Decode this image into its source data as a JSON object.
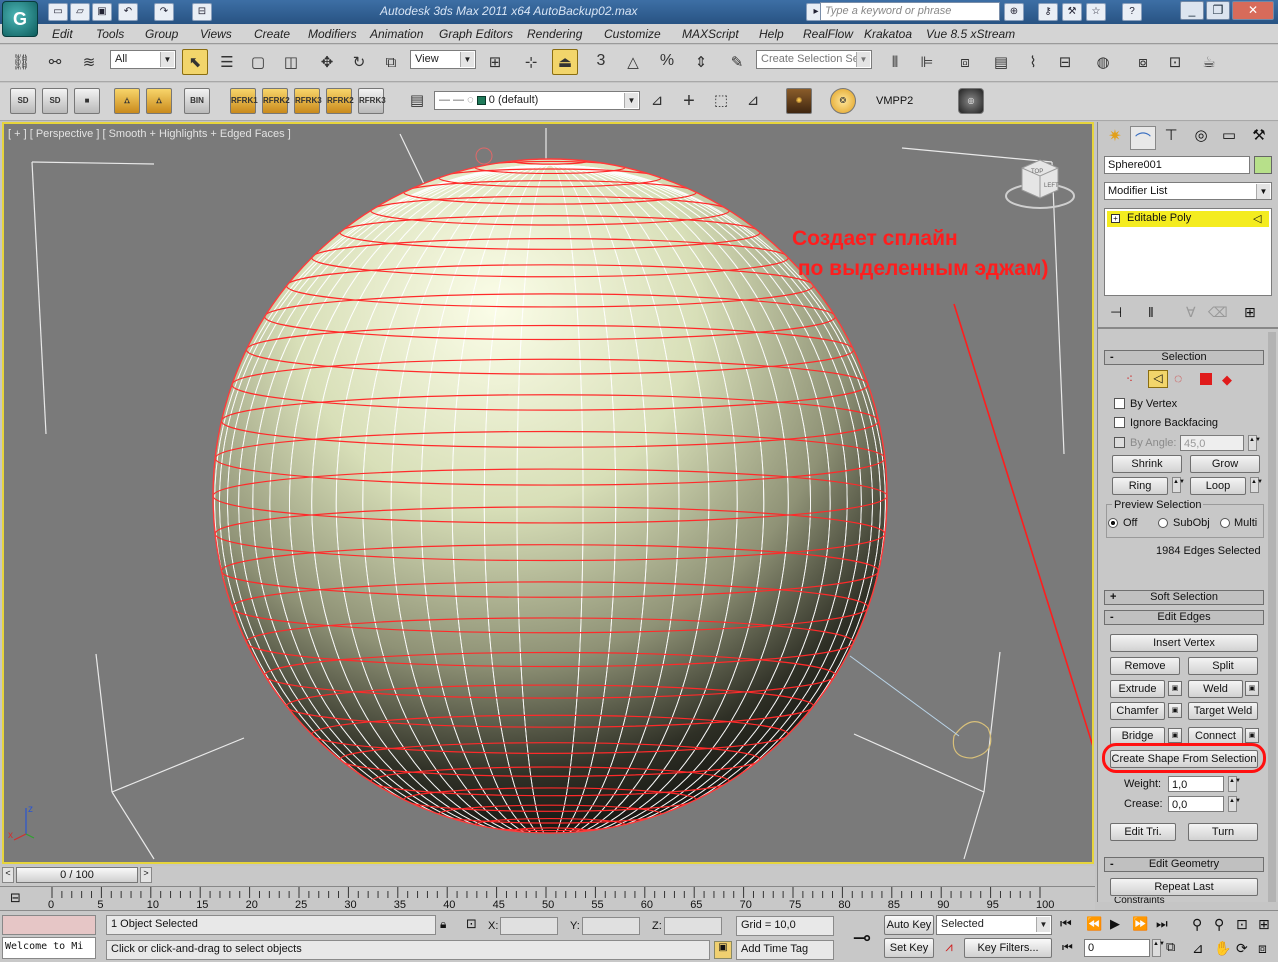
{
  "window": {
    "title": "Autodesk 3ds Max  2011 x64      AutoBackup02.max",
    "app_icon": "3ds-max-logo-icon",
    "search_placeholder": "Type a keyword or phrase",
    "controls": [
      "minimize",
      "restore",
      "close"
    ]
  },
  "menubar": {
    "items": [
      "Edit",
      "Tools",
      "Group",
      "Views",
      "Create",
      "Modifiers",
      "Animation",
      "Graph Editors",
      "Rendering",
      "Customize",
      "MAXScript",
      "Help",
      "RealFlow",
      "Krakatoa",
      "Vue 8.5 xStream"
    ]
  },
  "main_toolbar": {
    "selection_filter": "All",
    "ref_coord": "View",
    "named_selection_placeholder": "Create Selection Se",
    "snap_label": "3",
    "angle_snap_label": "%"
  },
  "extra_toolbar": {
    "layer_value": "0 (default)",
    "vmpp_label": "VMPP2",
    "rfrk_labels": [
      "RFRK1",
      "RFRK2",
      "RFRK3",
      "RFRK2",
      "RFRK3"
    ],
    "bin_label": "BIN",
    "sd_label": "SD"
  },
  "viewport": {
    "label": "[ + ] [ Perspective ] [ Smooth + Highlights + Edged Faces ]",
    "annotation_line1": "Создает сплайн",
    "annotation_line2": " по выделенным эджам)",
    "viewcube_labels": [
      "TOP",
      "LEFT"
    ],
    "axis_labels": [
      "z",
      "x"
    ]
  },
  "command_panel": {
    "tab_icons": [
      "create-icon",
      "modify-icon",
      "hierarchy-icon",
      "motion-icon",
      "display-icon",
      "utilities-icon"
    ],
    "object_name": "Sphere001",
    "object_color": "#b7e08a",
    "modifier_list": "Modifier List",
    "stack_item": "Editable Poly",
    "selection": {
      "title": "Selection",
      "by_vertex": "By Vertex",
      "ignore_backfacing": "Ignore Backfacing",
      "by_angle": "By Angle:",
      "by_angle_value": "45,0",
      "shrink": "Shrink",
      "grow": "Grow",
      "ring": "Ring",
      "loop": "Loop",
      "preview_selection": "Preview Selection",
      "preview_options": [
        "Off",
        "SubObj",
        "Multi"
      ],
      "status": "1984 Edges Selected"
    },
    "soft_selection": {
      "title": "Soft Selection"
    },
    "edit_edges": {
      "title": "Edit Edges",
      "insert_vertex": "Insert Vertex",
      "remove": "Remove",
      "split": "Split",
      "extrude": "Extrude",
      "weld": "Weld",
      "chamfer": "Chamfer",
      "target_weld": "Target Weld",
      "bridge": "Bridge",
      "connect": "Connect",
      "create_shape": "Create Shape From Selection",
      "weight_label": "Weight:",
      "weight_value": "1,0",
      "crease_label": "Crease:",
      "crease_value": "0,0",
      "edit_tri": "Edit Tri.",
      "turn": "Turn"
    },
    "edit_geometry": {
      "title": "Edit Geometry",
      "repeat_last": "Repeat Last",
      "constraints": "Constraints"
    }
  },
  "timeline": {
    "frame_indicator": "0 / 100",
    "ticks": [
      "0",
      "5",
      "10",
      "15",
      "20",
      "25",
      "30",
      "35",
      "40",
      "45",
      "50",
      "55",
      "60",
      "65",
      "70",
      "75",
      "80",
      "85",
      "90",
      "95",
      "100"
    ]
  },
  "status_bar": {
    "script_listener": "Welcome to Mi",
    "selection_info": "1 Object Selected",
    "prompt": "Click or click-and-drag to select objects",
    "x_label": "X:",
    "y_label": "Y:",
    "z_label": "Z:",
    "grid": "Grid = 10,0",
    "add_time_tag": "Add Time Tag",
    "auto_key": "Auto Key",
    "set_key": "Set Key",
    "selected_dropdown": "Selected",
    "key_filters": "Key Filters...",
    "current_frame": "0"
  }
}
